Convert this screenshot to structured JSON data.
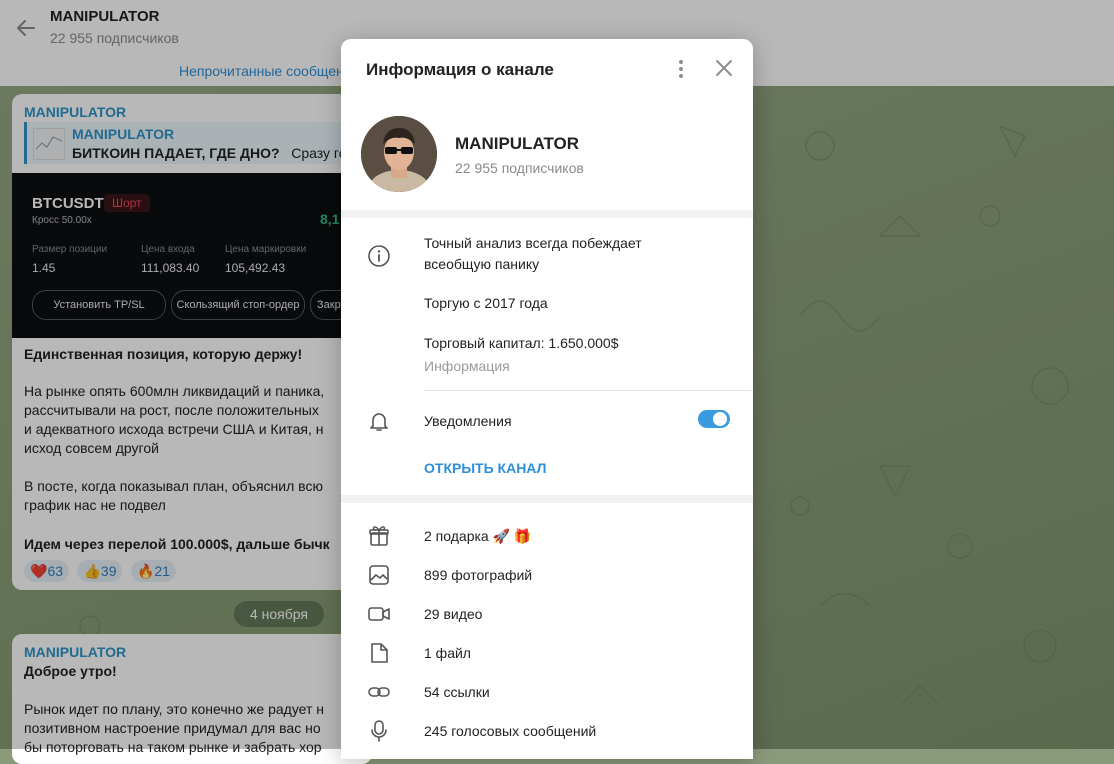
{
  "chat": {
    "title": "MANIPULATOR",
    "subscribers": "22 955 подписчиков",
    "pinned_label": "Непрочитанные сообщения"
  },
  "message1": {
    "author": "MANIPULATOR",
    "reply_author": "MANIPULATOR",
    "reply_bold": "БИТКОИН ПАДАЕТ, ГДЕ ДНО?",
    "reply_rest": "Сразу го",
    "trade": {
      "pair": "BTCUSDT",
      "side": "Шорт",
      "margin": "Кросс 50.00x",
      "pnl": "8,1",
      "size_label": "Размер позиции",
      "size_value": "1.45",
      "entry_label": "Цена входа",
      "entry_value": "111,083.40",
      "mark_label": "Цена маркировки",
      "mark_value": "105,492.43",
      "btn_tpsl": "Установить TP/SL",
      "btn_trailing": "Скользящий стоп-ордер",
      "btn_close": "Закр"
    },
    "heading": "Единственная позиция, которую держу!",
    "para1": [
      "На рынке опять 600млн ликвидаций и паника,",
      "рассчитывали на рост, после положительных",
      "и адекватного исхода встречи США и Китая, н",
      "исход совсем другой"
    ],
    "para2": [
      "В посте, когда показывал план, объяснил всю",
      "график нас не подвел"
    ],
    "closing": "Идем через перелой 100.000$, дальше бычк",
    "reactions": [
      {
        "emoji": "❤️",
        "count": "63"
      },
      {
        "emoji": "👍",
        "count": "39"
      },
      {
        "emoji": "🔥",
        "count": "21"
      }
    ]
  },
  "date_chip": "4 ноября",
  "message2": {
    "author": "MANIPULATOR",
    "heading": "Доброе утро!",
    "lines": [
      "Рынок идет по плану, это конечно же радует н",
      "позитивном настроение придумал для вас но",
      "бы поторговать на таком рынке и забрать хор"
    ]
  },
  "modal": {
    "title": "Информация о канале",
    "channel_name": "MANIPULATOR",
    "subscribers": "22 955 подписчиков",
    "description_line1": "Точный анализ всегда побеждает",
    "description_line2": "всеобщую панику",
    "trading_since": "Торгую с 2017 года",
    "capital": "Торговый капитал: 1.650.000$",
    "info_caption": "Информация",
    "notifications_label": "Уведомления",
    "notifications_on": true,
    "open_channel": "ОТКРЫТЬ КАНАЛ",
    "media": {
      "gifts": "2 подарка 🚀 🎁",
      "photos": "899 фотографий",
      "videos": "29 видео",
      "files": "1 файл",
      "links": "54 ссылки",
      "voice": "245 голосовых сообщений"
    }
  },
  "colors": {
    "accent": "#2e8fd8",
    "toggle_on": "#3a9be0",
    "short_red": "#f6465d",
    "pnl_green": "#2ebd85"
  }
}
